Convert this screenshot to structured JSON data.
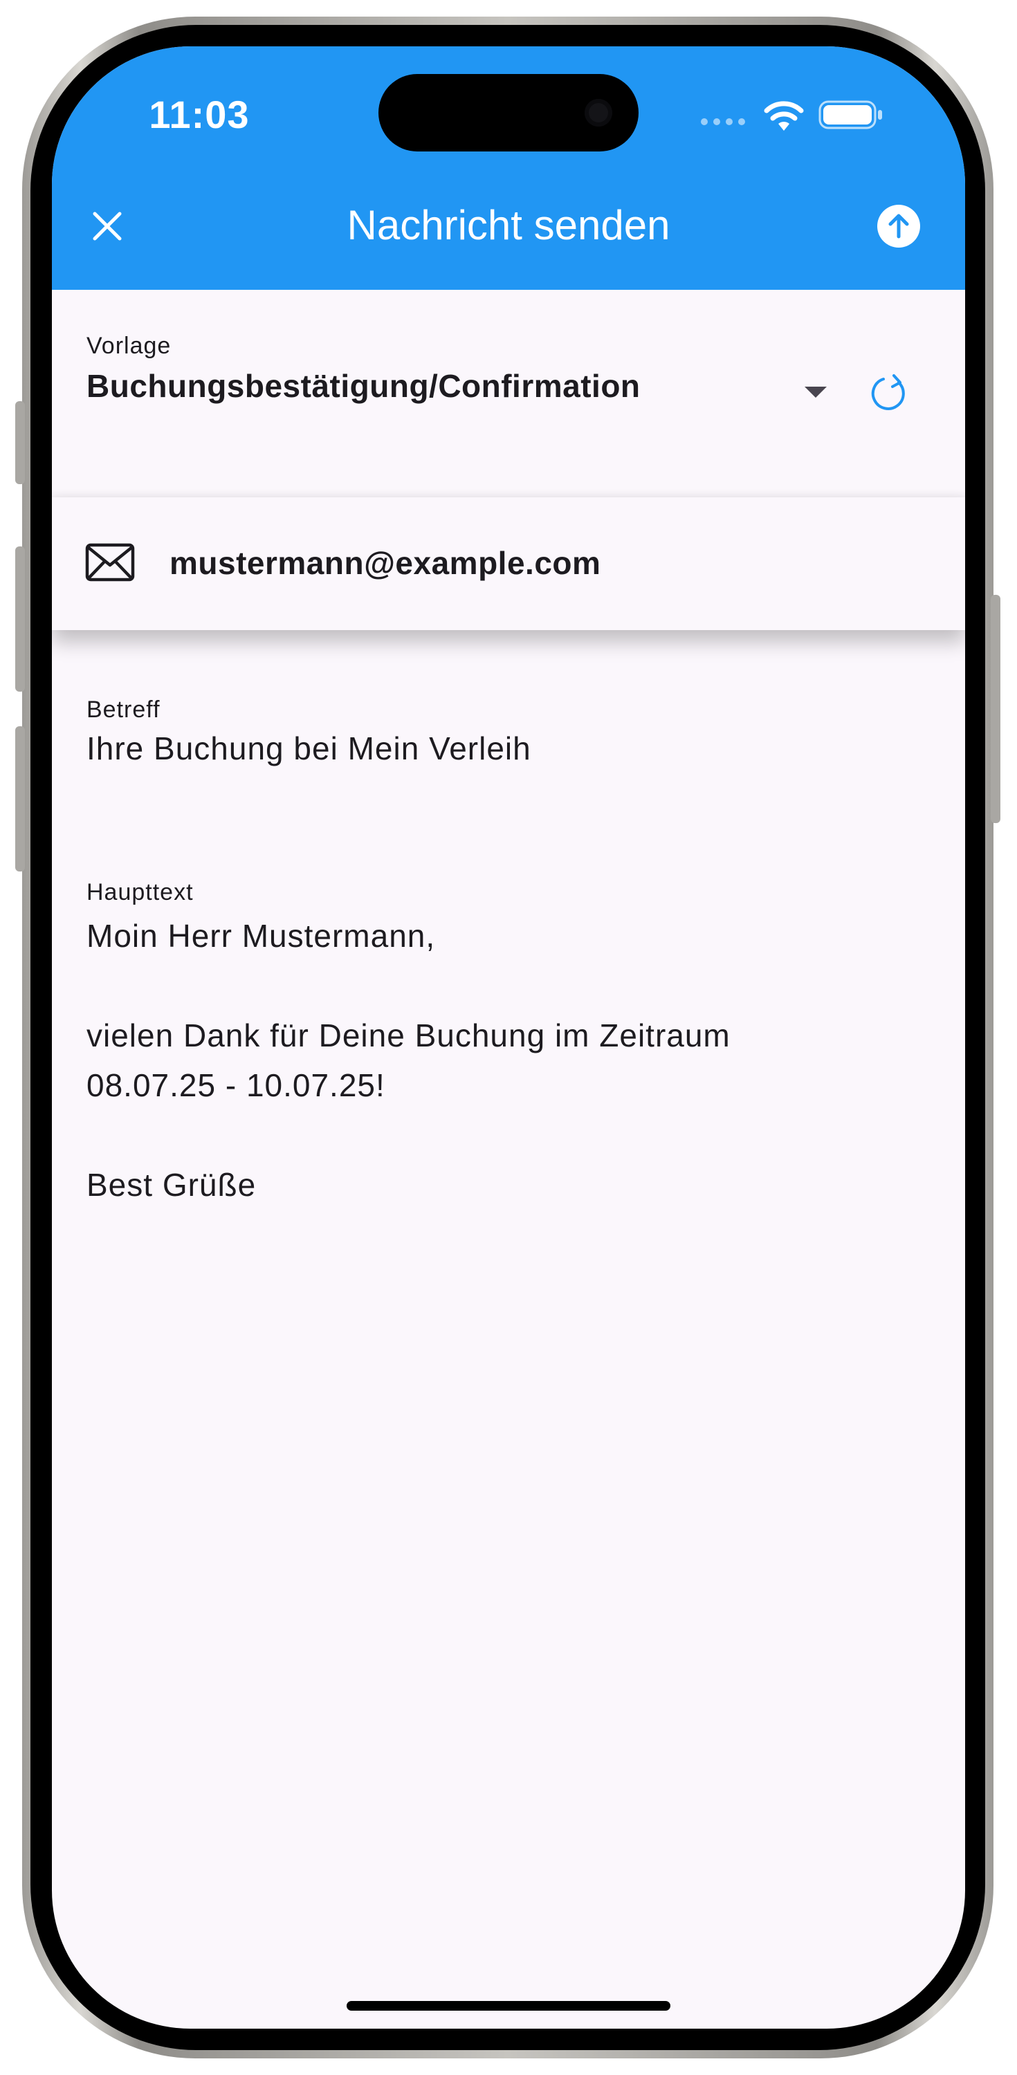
{
  "status_bar": {
    "time": "11:03",
    "icons": [
      "cellular-signal-icon",
      "wifi-icon",
      "battery-icon"
    ]
  },
  "app_bar": {
    "title": "Nachricht senden",
    "close_icon": "close-icon",
    "send_icon": "send-arrow-up-icon",
    "background_color": "#2196f3"
  },
  "template": {
    "label": "Vorlage",
    "selected_value": "Buchungsbestätigung/Confirmation",
    "dropdown_icon": "dropdown-arrow-icon",
    "refresh_icon": "refresh-icon"
  },
  "recipient": {
    "icon": "mail-icon",
    "email": "mustermann@example.com"
  },
  "subject": {
    "label": "Betreff",
    "value": "Ihre Buchung bei Mein Verleih"
  },
  "body": {
    "label": "Haupttext",
    "lines": [
      "Moin Herr Mustermann,",
      "",
      "vielen Dank für Deine Buchung im Zeitraum",
      "08.07.25 - 10.07.25!",
      "",
      "Best Grüße"
    ]
  }
}
